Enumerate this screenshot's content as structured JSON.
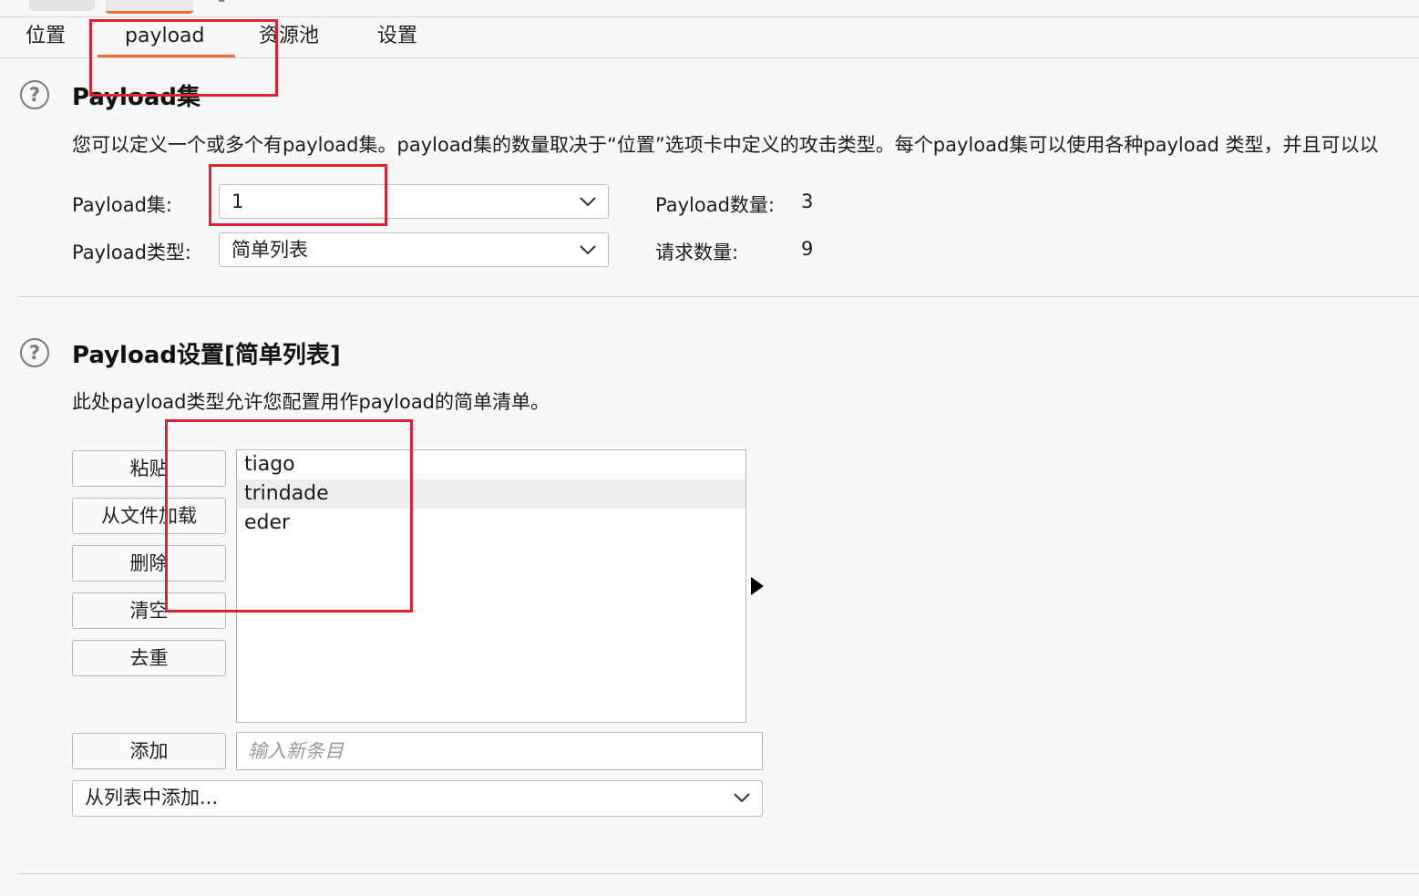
{
  "tabs": [
    {
      "label": "位置"
    },
    {
      "label": "payload",
      "active": true
    },
    {
      "label": "资源池"
    },
    {
      "label": "设置"
    }
  ],
  "payload_sets": {
    "title": "Payload集",
    "description": "您可以定义一个或多个有payload集。payload集的数量取决于“位置”选项卡中定义的攻击类型。每个payload集可以使用各种payload 类型，并且可以以",
    "set_label": "Payload集:",
    "set_value": "1",
    "type_label": "Payload类型:",
    "type_value": "简单列表",
    "count_label": "Payload数量:",
    "count_value": "3",
    "requests_label": "请求数量:",
    "requests_value": "9"
  },
  "payload_settings": {
    "title": "Payload设置[简单列表]",
    "description": "此处payload类型允许您配置用作payload的简单清单。",
    "buttons": {
      "paste": "粘贴",
      "load": "从文件加载",
      "remove": "删除",
      "clear": "清空",
      "dedupe": "去重",
      "add": "添加"
    },
    "items": [
      "tiago",
      "trindade",
      "eder"
    ],
    "selected_index": 1,
    "new_item_placeholder": "输入新条目",
    "add_from_list": "从列表中添加..."
  },
  "colors": {
    "accent": "#f06a33",
    "highlight_box": "#e3202f"
  },
  "icons": [
    "help-icon",
    "chevron-down-icon",
    "expand-arrow-icon"
  ]
}
